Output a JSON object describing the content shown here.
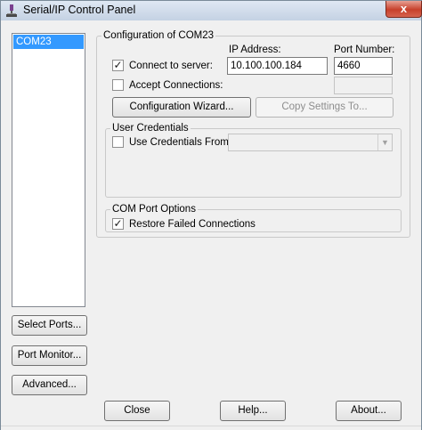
{
  "window": {
    "title": "Serial/IP Control Panel",
    "close_glyph": "x"
  },
  "ports_list": {
    "items": [
      "COM23"
    ],
    "selected": "COM23"
  },
  "left_buttons": {
    "select_ports": "Select Ports...",
    "port_monitor": "Port Monitor...",
    "advanced": "Advanced..."
  },
  "config": {
    "group_title": "Configuration of COM23",
    "ip_address_label": "IP Address:",
    "port_number_label": "Port Number:",
    "connect_to_server_label": "Connect to server:",
    "connect_to_server_checked": true,
    "ip_address_value": "10.100.100.184",
    "port_number_value": "4660",
    "accept_connections_label": "Accept Connections:",
    "accept_connections_checked": false,
    "accept_port_value": "",
    "wizard_button": "Configuration Wizard...",
    "copy_settings_button": "Copy Settings To..."
  },
  "credentials": {
    "group_title": "User Credentials",
    "use_credentials_label": "Use Credentials From:",
    "use_credentials_checked": false,
    "credentials_source_value": ""
  },
  "com_options": {
    "group_title": "COM Port Options",
    "restore_failed_label": "Restore Failed Connections",
    "restore_failed_checked": true
  },
  "footer": {
    "close_button": "Close",
    "help_button": "Help...",
    "about_button": "About..."
  },
  "glyphs": {
    "check": "✓",
    "combo_arrow": "▼"
  },
  "icons": {
    "app": "serial-ip-app-icon"
  }
}
